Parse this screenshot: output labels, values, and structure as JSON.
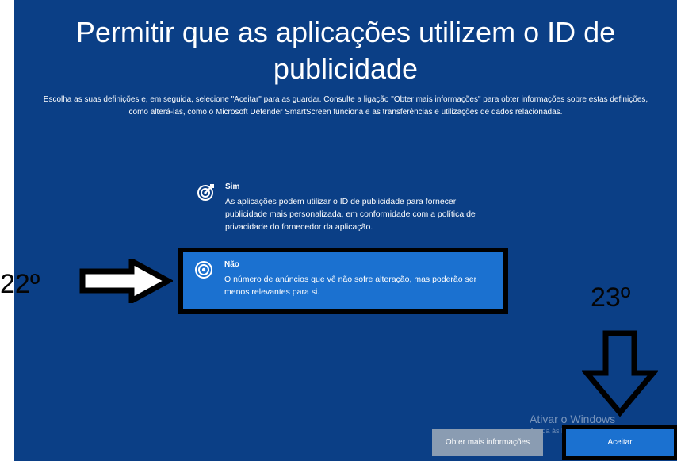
{
  "colors": {
    "background": "#0b3f86",
    "selected_option": "#1b71d0",
    "accept_button": "#1b71d0",
    "info_button": "#8a9cb2",
    "annotation": "#000000"
  },
  "page": {
    "title_line1": "Permitir que as aplicações utilizem o ID de",
    "title_line2": "publicidade",
    "description": "Escolha as suas definições e, em seguida, selecione \"Aceitar\" para as guardar. Consulte a ligação \"Obter mais informações\" para obter informações sobre estas definições, como alterá-las, como o Microsoft Defender SmartScreen funciona e as transferências e utilizações de dados relacionadas."
  },
  "options": [
    {
      "title": "Sim",
      "text": "As aplicações podem utilizar o ID de publicidade para fornecer publicidade mais personalizada, em conformidade com a política de privacidade do fornecedor da aplicação.",
      "icon": "target-check-icon",
      "selected": false
    },
    {
      "title": "Não",
      "text": "O número de anúncios que vê não sofre alteração, mas poderão ser menos relevantes para si.",
      "icon": "target-icon",
      "selected": true
    }
  ],
  "annotations": {
    "step_left": "22º",
    "step_right": "23º"
  },
  "watermark": {
    "title": "Ativar o Windows",
    "subtitle": "Aceda às Definições para ativar o Windows."
  },
  "buttons": {
    "more_info": "Obter mais informações",
    "accept": "Aceitar"
  }
}
